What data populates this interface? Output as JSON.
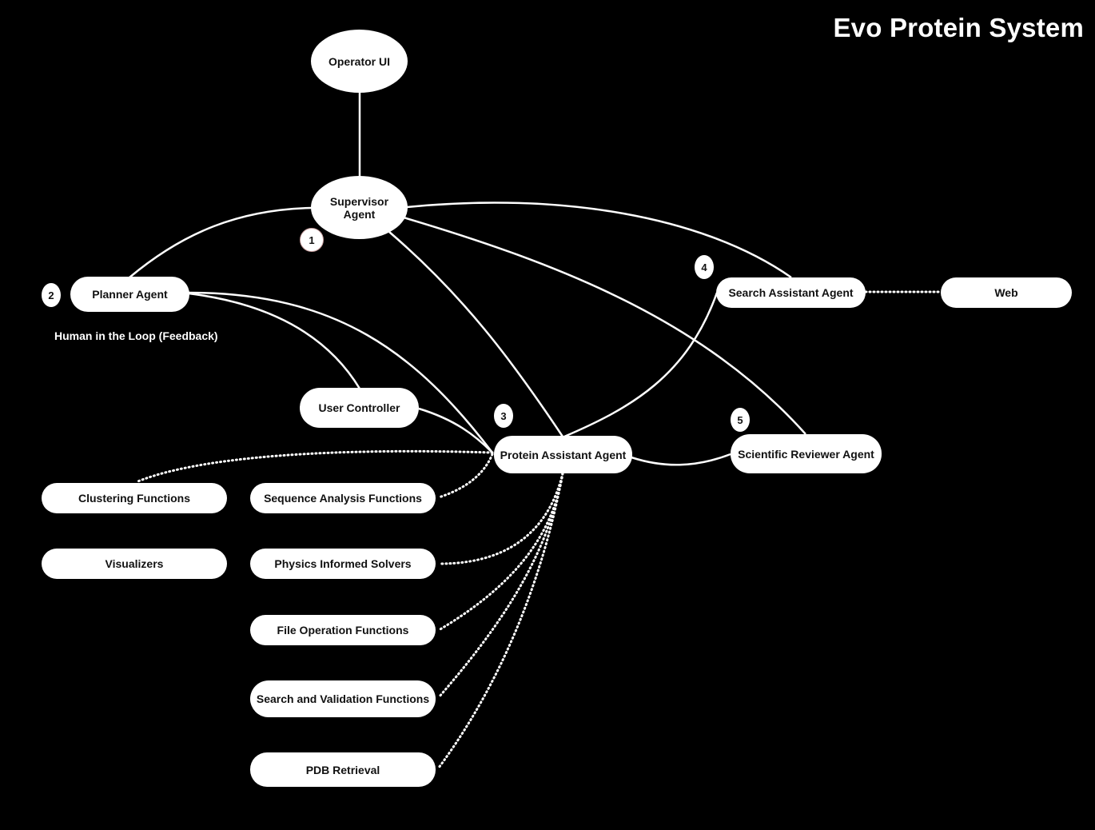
{
  "title": "Evo Protein System",
  "nodes": {
    "operator_ui": "Operator UI",
    "supervisor_agent": "Supervisor\nAgent",
    "planner_agent": "Planner Agent",
    "search_assistant_agent": "Search Assistant Agent",
    "web": "Web",
    "user_controller": "User Controller",
    "protein_assistant_agent": "Protein Assistant Agent",
    "scientific_reviewer_agent": "Scientific Reviewer Agent",
    "clustering_functions": "Clustering Functions",
    "sequence_analysis_functions": "Sequence Analysis Functions",
    "visualizers": "Visualizers",
    "physics_informed_solvers": "Physics Informed Solvers",
    "file_operation_functions": "File Operation Functions",
    "search_and_validation_functions": "Search and Validation Functions",
    "pdb_retrieval": "PDB Retrieval"
  },
  "badges": {
    "supervisor_step": "1",
    "planner_step": "2",
    "protein_step": "3",
    "search_step": "4",
    "reviewer_step": "5"
  },
  "notes": {
    "human_in_loop": "Human in the Loop (Feedback)"
  },
  "edges": [
    {
      "from": "operator_ui",
      "to": "supervisor_agent",
      "style": "solid"
    },
    {
      "from": "supervisor_agent",
      "to": "planner_agent",
      "style": "solid"
    },
    {
      "from": "supervisor_agent",
      "to": "search_assistant_agent",
      "style": "solid"
    },
    {
      "from": "supervisor_agent",
      "to": "protein_assistant_agent",
      "style": "solid"
    },
    {
      "from": "supervisor_agent",
      "to": "scientific_reviewer_agent",
      "style": "solid"
    },
    {
      "from": "planner_agent",
      "to": "user_controller",
      "style": "solid"
    },
    {
      "from": "planner_agent",
      "to": "protein_assistant_agent",
      "style": "solid"
    },
    {
      "from": "user_controller",
      "to": "protein_assistant_agent",
      "style": "solid"
    },
    {
      "from": "search_assistant_agent",
      "to": "protein_assistant_agent",
      "style": "solid"
    },
    {
      "from": "protein_assistant_agent",
      "to": "scientific_reviewer_agent",
      "style": "solid"
    },
    {
      "from": "search_assistant_agent",
      "to": "web",
      "style": "dotted"
    },
    {
      "from": "protein_assistant_agent",
      "to": "clustering_functions",
      "style": "dotted"
    },
    {
      "from": "protein_assistant_agent",
      "to": "sequence_analysis_functions",
      "style": "dotted"
    },
    {
      "from": "protein_assistant_agent",
      "to": "physics_informed_solvers",
      "style": "dotted"
    },
    {
      "from": "protein_assistant_agent",
      "to": "file_operation_functions",
      "style": "dotted"
    },
    {
      "from": "protein_assistant_agent",
      "to": "search_and_validation_functions",
      "style": "dotted"
    },
    {
      "from": "protein_assistant_agent",
      "to": "pdb_retrieval",
      "style": "dotted"
    }
  ],
  "colors": {
    "background": "#000000",
    "node_fill": "#ffffff",
    "node_text": "#111111",
    "edge": "#ffffff"
  }
}
